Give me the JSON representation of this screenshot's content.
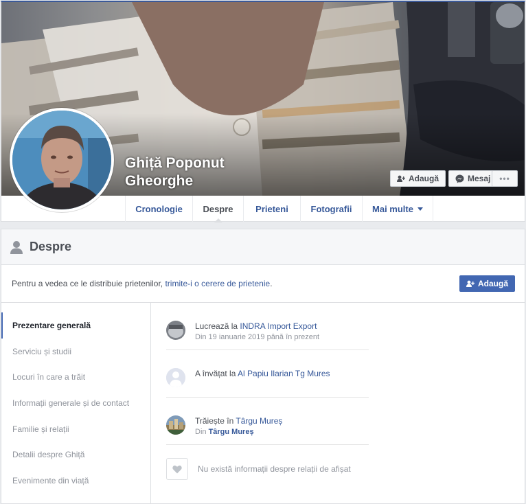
{
  "profile": {
    "name_line1": "Ghiță Poponut",
    "name_line2": "Gheorghe"
  },
  "cover_actions": {
    "add_label": "Adaugă",
    "message_label": "Mesaj",
    "more_label": "•••"
  },
  "tabs": [
    {
      "label": "Cronologie"
    },
    {
      "label": "Despre"
    },
    {
      "label": "Prieteni"
    },
    {
      "label": "Fotografii"
    },
    {
      "label": "Mai multe"
    }
  ],
  "about": {
    "title": "Despre",
    "friend_prompt_before": "Pentru a vedea ce le distribuie prietenilor, ",
    "friend_prompt_link": "trimite-i o cerere de prietenie",
    "friend_prompt_after": ".",
    "add_button": "Adaugă"
  },
  "nav": [
    {
      "label": "Prezentare generală"
    },
    {
      "label": "Serviciu și studii"
    },
    {
      "label": "Locuri în care a trăit"
    },
    {
      "label": "Informații generale și de contact"
    },
    {
      "label": "Familie și relații"
    },
    {
      "label": "Detalii despre Ghiță"
    },
    {
      "label": "Evenimente din viață"
    }
  ],
  "overview": {
    "work": {
      "prefix": "Lucrează la ",
      "link": "INDRA Import Export",
      "sub": "Din 19 ianuarie 2019 până în prezent"
    },
    "education": {
      "prefix": "A învățat la ",
      "link": "Al Papiu Ilarian Tg Mures"
    },
    "lives": {
      "prefix": "Trăiește în ",
      "link": "Târgu Mureș",
      "sub_prefix": "Din ",
      "sub_link": "Târgu Mureș"
    },
    "relationship": {
      "text": "Nu există informații despre relații de afișat"
    }
  },
  "colors": {
    "brand_blue": "#4267b2",
    "link_blue": "#365899",
    "page_bg": "#e9ebee"
  }
}
